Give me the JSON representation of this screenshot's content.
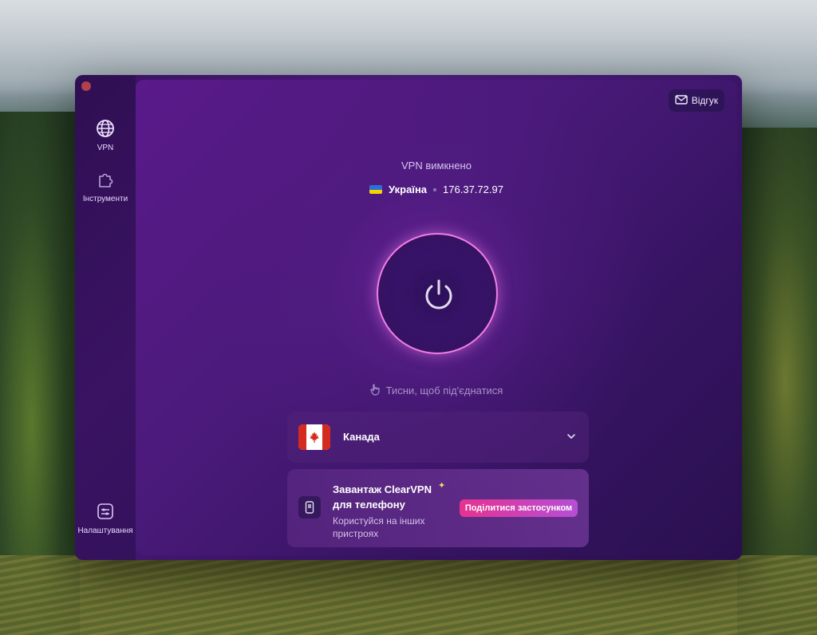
{
  "sidebar": {
    "items": [
      {
        "label": "VPN",
        "icon": "globe-icon"
      },
      {
        "label": "Інструменти",
        "icon": "puzzle-icon"
      }
    ],
    "settings": {
      "label": "Налаштування",
      "icon": "settings-icon"
    }
  },
  "header": {
    "feedback_label": "Відгук",
    "feedback_icon": "envelope-icon"
  },
  "status": {
    "text": "VPN вимкнено",
    "country": "Україна",
    "ip": "176.37.72.97"
  },
  "power": {
    "icon": "power-icon",
    "hint": "Тисни, щоб під'єднатися",
    "hint_icon": "hand-pointer-icon"
  },
  "location_select": {
    "selected": "Канада",
    "flag": "canada-flag-icon"
  },
  "promo": {
    "title": "Завантаж ClearVPN для телефону",
    "subtitle": "Користуйся на інших пристроях",
    "button": "Поділитися застосунком"
  },
  "colors": {
    "accent_ring": "#f27ee8",
    "share_button_start": "#e6338f",
    "share_button_end": "#b54fd6",
    "close_button": "#ff5f57"
  }
}
